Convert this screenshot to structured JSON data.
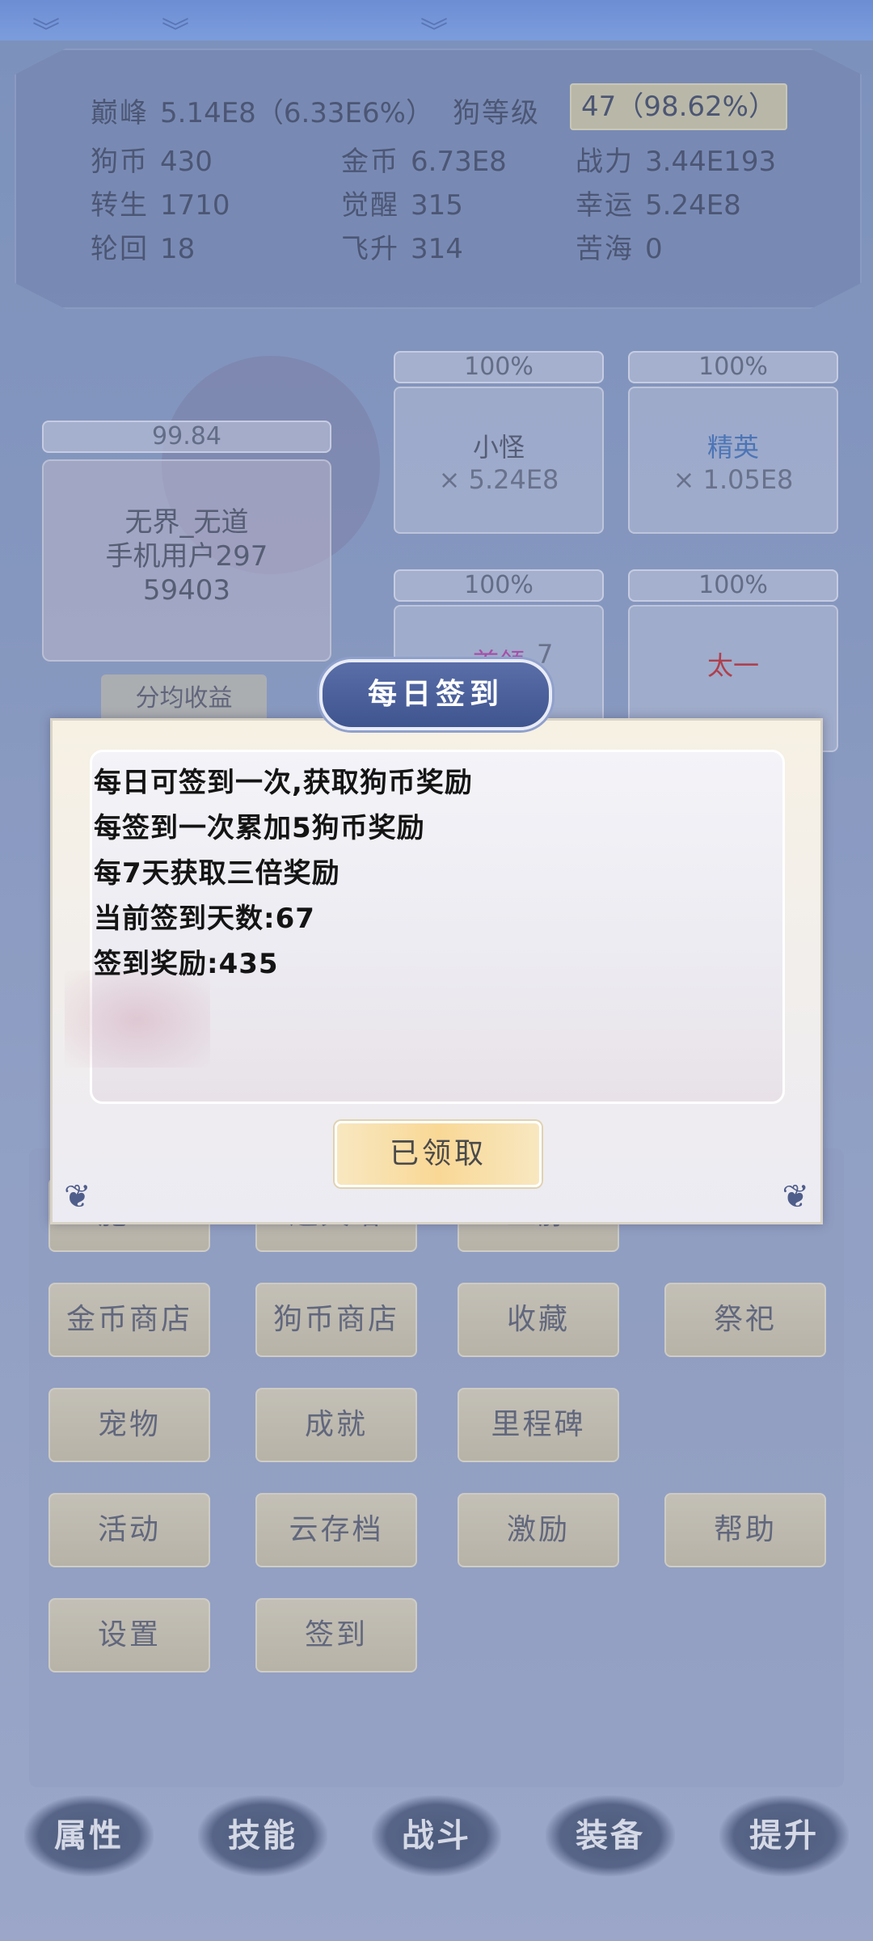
{
  "stats": {
    "peak_label": "巅峰",
    "peak_value": "5.14E8（6.33E6%）",
    "dog_level_label": "狗等级",
    "dog_level_value": "47（98.62%）",
    "rows": [
      {
        "k1": "狗币",
        "v1": "430",
        "k2": "金币",
        "v2": "6.73E8",
        "k3": "战力",
        "v3": "3.44E193"
      },
      {
        "k1": "转生",
        "v1": "1710",
        "k2": "觉醒",
        "v2": "315",
        "k3": "幸运",
        "v3": "5.24E8"
      },
      {
        "k1": "轮回",
        "v1": "18",
        "k2": "飞升",
        "v2": "314",
        "k3": "苦海",
        "v3": "0"
      }
    ]
  },
  "player": {
    "progress": "99.84",
    "name_line1": "无界_无道",
    "name_line2": "手机用户297",
    "name_line3": "59403",
    "avg_button": "分均收益"
  },
  "enemies": [
    {
      "progress": "100%",
      "title": "小怪",
      "count": "× 5.24E8",
      "color": "#4a4f63"
    },
    {
      "progress": "100%",
      "title": "精英",
      "count": "× 1.05E8",
      "color": "#3e6fb8"
    },
    {
      "progress": "100%",
      "title": "首领",
      "count": "7",
      "color": "#b43ea6"
    },
    {
      "progress": "100%",
      "title": "太一",
      "count": "",
      "color": "#c0282c"
    }
  ],
  "grid": {
    "row0": [
      "施工",
      "通天塔",
      "血脉"
    ],
    "row1": [
      "金币商店",
      "狗币商店",
      "收藏",
      "祭祀"
    ],
    "row2": [
      "宠物",
      "成就",
      "里程碑"
    ],
    "row3": [
      "活动",
      "云存档",
      "激励",
      "帮助"
    ],
    "row4": [
      "设置",
      "签到"
    ]
  },
  "nav": [
    "属性",
    "技能",
    "战斗",
    "装备",
    "提升"
  ],
  "dialog": {
    "title": "每日签到",
    "lines": [
      "每日可签到一次,获取狗币奖励",
      "每签到一次累加5狗币奖励",
      "每7天获取三倍奖励",
      "当前签到天数:67",
      "签到奖励:435"
    ],
    "claimed_button": "已领取"
  },
  "hidden_label": "苦海"
}
